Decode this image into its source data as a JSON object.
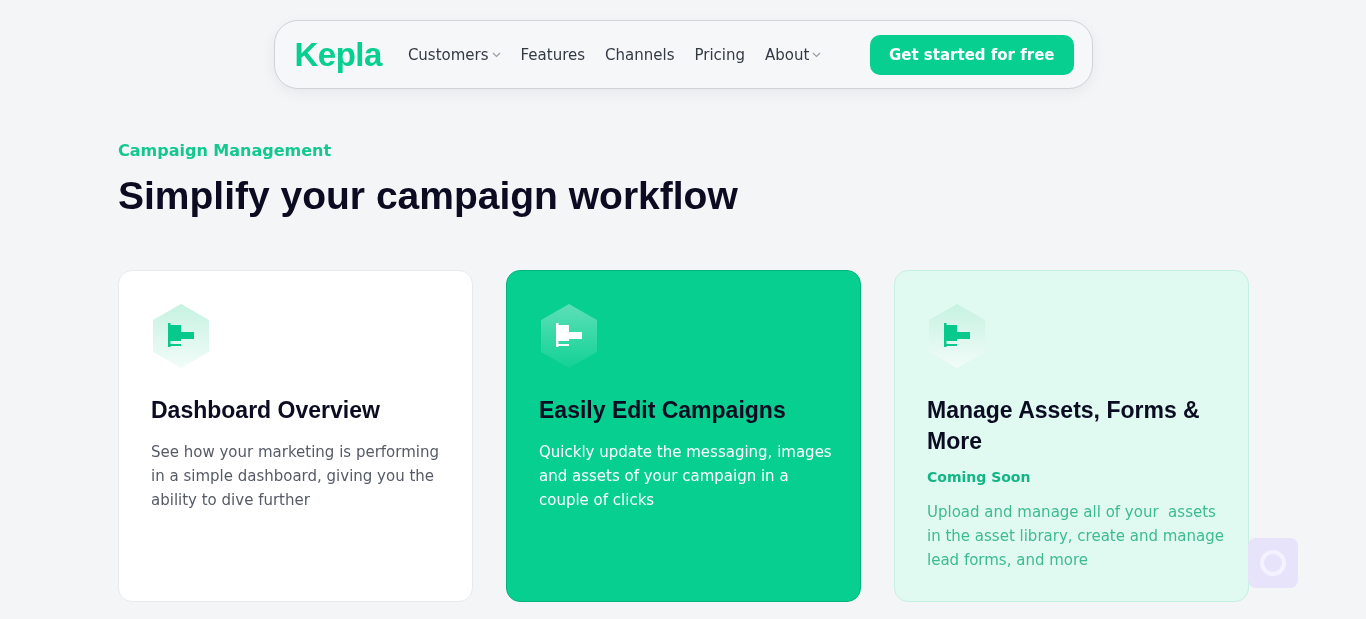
{
  "nav": {
    "logo": "Kepla",
    "links": [
      {
        "label": "Customers",
        "dropdown": true
      },
      {
        "label": "Features",
        "dropdown": false
      },
      {
        "label": "Channels",
        "dropdown": false
      },
      {
        "label": "Pricing",
        "dropdown": false
      },
      {
        "label": "About",
        "dropdown": true
      }
    ],
    "cta": "Get started for free"
  },
  "section": {
    "eyebrow": "Campaign Management",
    "title": "Simplify your campaign workflow"
  },
  "cards": [
    {
      "kind": "plain",
      "title": "Dashboard Overview",
      "description": "See how your marketing is performing in a simple dashboard, giving you the ability to dive further"
    },
    {
      "kind": "highlight",
      "title": "Easily Edit Campaigns",
      "description": "Quickly update the messaging, images and assets of your campaign in a couple of clicks"
    },
    {
      "kind": "soon",
      "title": "Manage Assets, Forms & More",
      "badge": "Coming Soon",
      "description": "Upload and manage all of your  assets in the asset library, create and manage lead forms, and more"
    }
  ]
}
